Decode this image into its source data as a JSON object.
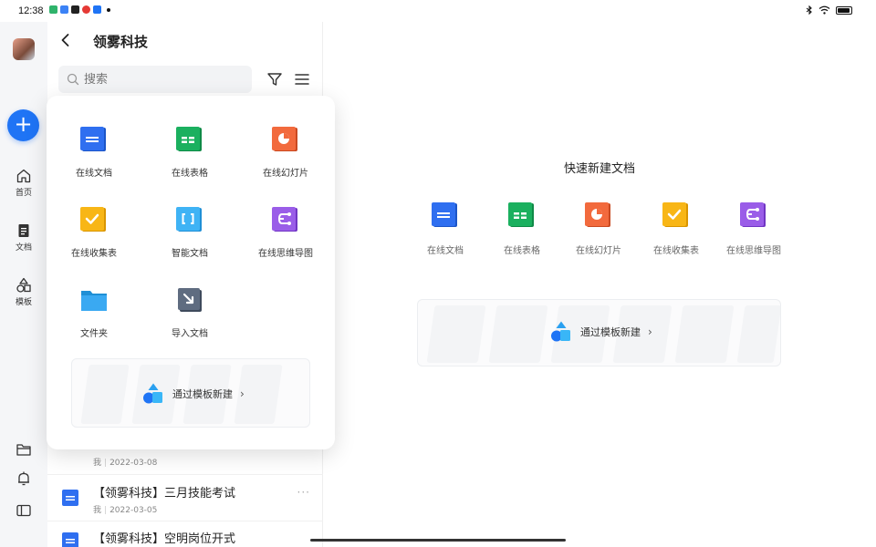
{
  "status_bar": {
    "time": "12:38"
  },
  "header": {
    "title": "领雾科技"
  },
  "rail": {
    "items": [
      {
        "label": "首页"
      },
      {
        "label": "文档"
      },
      {
        "label": "模板"
      }
    ]
  },
  "search": {
    "placeholder": "搜索"
  },
  "popup": {
    "items": [
      {
        "label": "在线文档",
        "icon": "doc-icon",
        "color": "#2f6ff0"
      },
      {
        "label": "在线表格",
        "icon": "sheet-icon",
        "color": "#1bb05f"
      },
      {
        "label": "在线幻灯片",
        "icon": "slides-icon",
        "color": "#f26a3d"
      },
      {
        "label": "在线收集表",
        "icon": "form-icon",
        "color": "#f8b616"
      },
      {
        "label": "智能文档",
        "icon": "smart-doc-icon",
        "color": "#3fb3f5"
      },
      {
        "label": "在线思维导图",
        "icon": "mindmap-icon",
        "color": "#9a5de8"
      },
      {
        "label": "文件夹",
        "icon": "folder-icon",
        "color": "#3aa9f2"
      },
      {
        "label": "导入文档",
        "icon": "import-icon",
        "color": "#5f6c80"
      }
    ],
    "template_label": "通过模板新建"
  },
  "docs": [
    {
      "author": "我",
      "date": "2022-03-08"
    },
    {
      "title": "【领雾科技】三月技能考试",
      "author": "我",
      "date": "2022-03-05",
      "more": "···"
    },
    {
      "title": "【领雾科技】空明岗位开式"
    }
  ],
  "right_panel": {
    "title": "快速新建文档",
    "items": [
      {
        "label": "在线文档"
      },
      {
        "label": "在线表格"
      },
      {
        "label": "在线幻灯片"
      },
      {
        "label": "在线收集表"
      },
      {
        "label": "在线思维导图"
      }
    ],
    "template_label": "通过模板新建"
  }
}
